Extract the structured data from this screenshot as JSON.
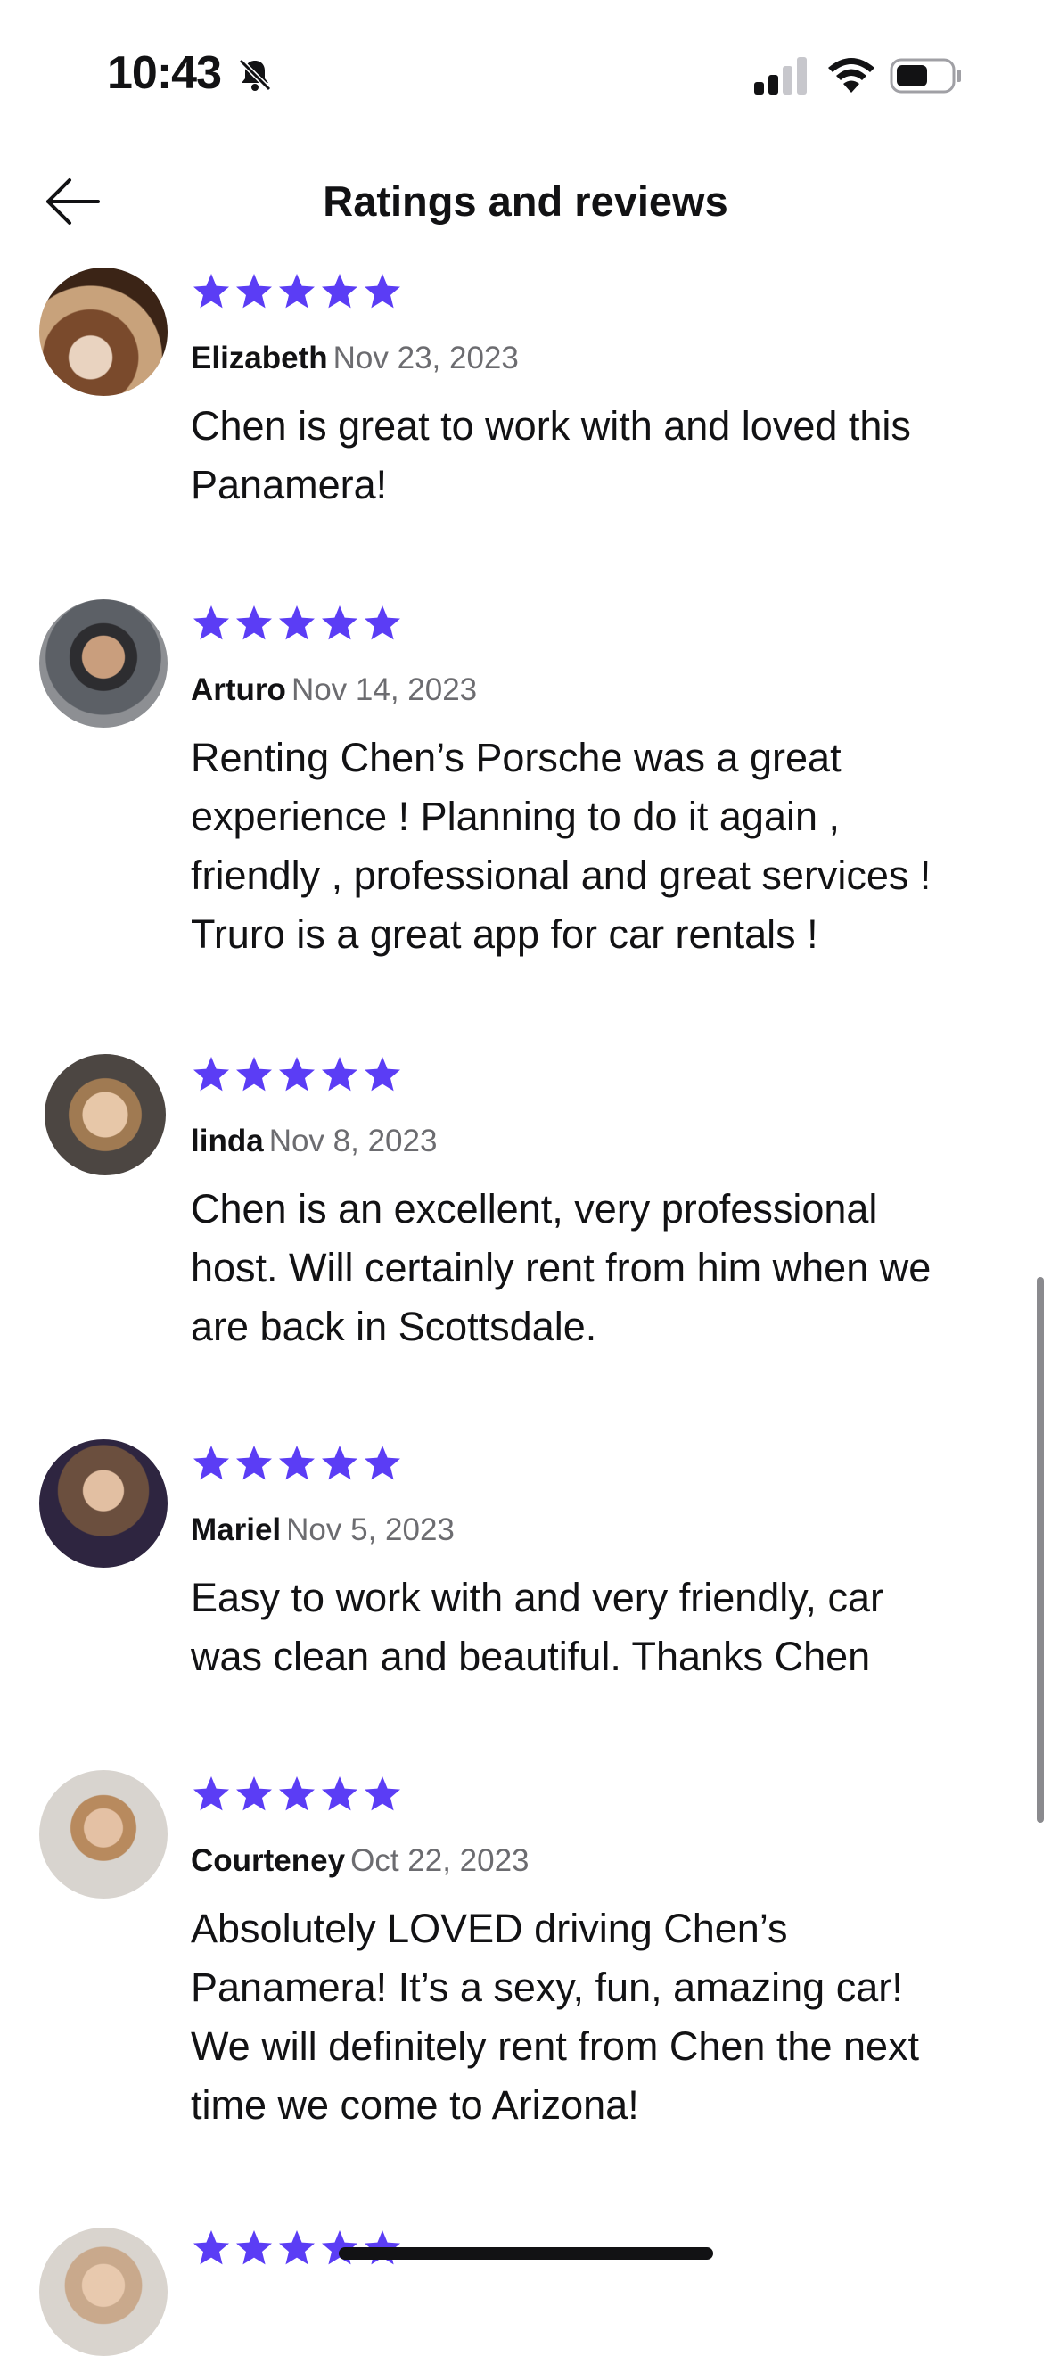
{
  "status_bar": {
    "time": "10:43"
  },
  "header": {
    "title": "Ratings and reviews"
  },
  "reviews": [
    {
      "name": "Elizabeth",
      "date": "Nov 23, 2023",
      "rating": 5,
      "lines": [
        "Chen is great to work with and loved this",
        "Panamera!"
      ]
    },
    {
      "name": "Arturo",
      "date": "Nov 14, 2023",
      "rating": 5,
      "lines": [
        "Renting Chen’s Porsche was a great",
        "experience ! Planning to do it again ,",
        "friendly , professional and great services !",
        "Truro is a great app for car rentals !"
      ]
    },
    {
      "name": "linda",
      "date": "Nov 8, 2023",
      "rating": 5,
      "lines": [
        "Chen is an excellent, very professional",
        "host.  Will certainly rent from him when we",
        "are back in Scottsdale."
      ]
    },
    {
      "name": "Mariel",
      "date": "Nov 5, 2023",
      "rating": 5,
      "lines": [
        "Easy to work with and very friendly, car",
        "was clean and beautiful. Thanks Chen"
      ]
    },
    {
      "name": "Courteney",
      "date": "Oct 22, 2023",
      "rating": 5,
      "lines": [
        "Absolutely LOVED driving Chen’s",
        "Panamera! It’s a sexy, fun, amazing car!",
        "We will definitely rent from Chen the next",
        "time we come to Arizona!"
      ]
    }
  ],
  "colors": {
    "star": "#5b3df5",
    "text": "#121214",
    "muted": "#6c6c70"
  },
  "icons": {
    "back": "arrow-left-icon",
    "star": "star-icon",
    "bell": "bell-slash-icon"
  }
}
